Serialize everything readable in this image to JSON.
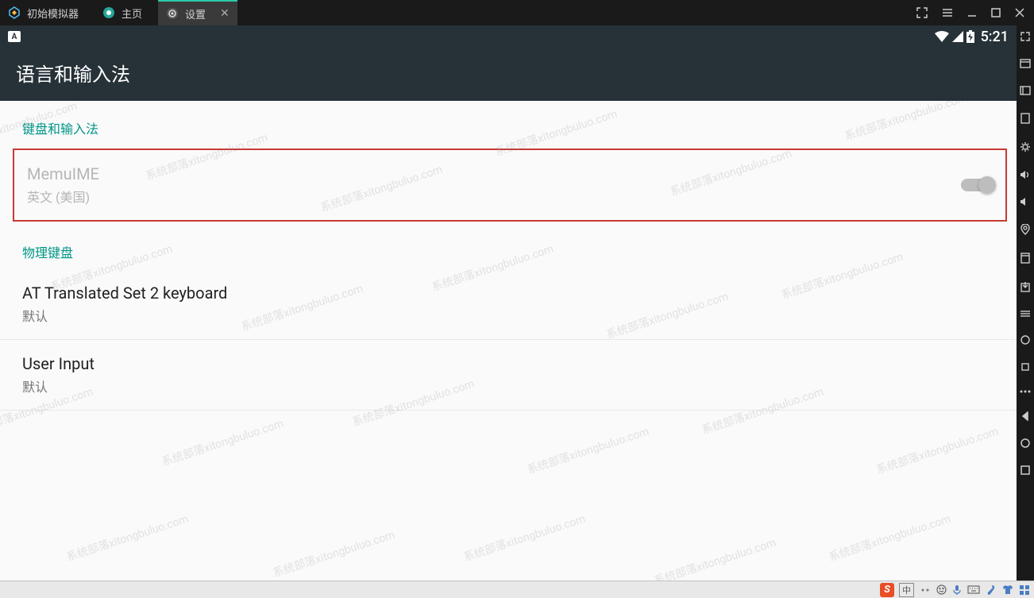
{
  "titlebar": {
    "tabs": [
      {
        "label": "初始模拟器"
      },
      {
        "label": "主页"
      },
      {
        "label": "设置"
      }
    ]
  },
  "statusbar": {
    "time": "5:21"
  },
  "page": {
    "title": "语言和输入法",
    "sections": [
      {
        "header": "键盘和输入法"
      },
      {
        "header": "物理键盘"
      }
    ],
    "items": [
      {
        "title": "MemuIME",
        "subtitle": "英文 (美国)"
      },
      {
        "title": "AT Translated Set 2 keyboard",
        "subtitle": "默认"
      },
      {
        "title": "User Input",
        "subtitle": "默认"
      }
    ]
  },
  "taskbar": {
    "ime_label": "中"
  },
  "watermark": "系统部落xitongbuluo.com"
}
